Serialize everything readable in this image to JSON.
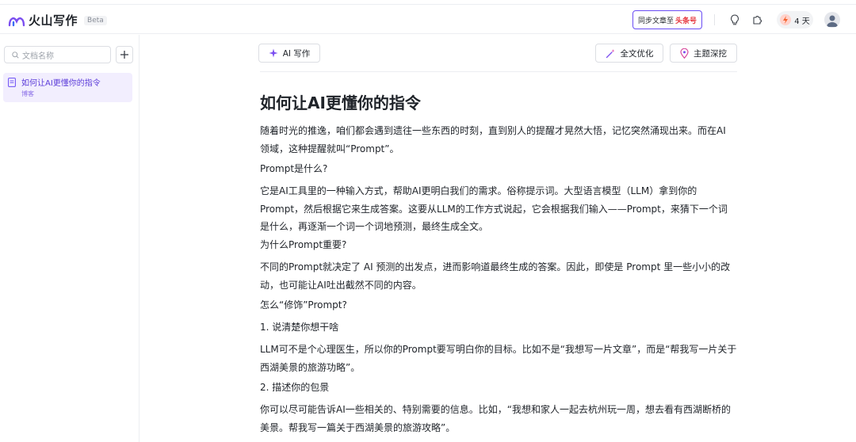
{
  "app": {
    "logo_text": "火山写作",
    "beta": "Beta"
  },
  "header": {
    "sync_prefix": "同步文章至",
    "sync_target": "头条号",
    "days": "4 天"
  },
  "sidebar": {
    "search_placeholder": "文档名称",
    "add_label": "+",
    "docs": [
      {
        "title": "如何让AI更懂你的指令",
        "subtitle": "博客"
      }
    ]
  },
  "toolbar": {
    "ai_write": "AI 写作",
    "optimize": "全文优化",
    "deep_dive": "主题深挖"
  },
  "document": {
    "title": "如何让AI更懂你的指令",
    "paragraphs": [
      [
        "随着时光的推逸，咱们都会遇到遗往一些东西的时刻，直到别人的提醒才晃然大悟，记忆突然涌现出来。而在AI",
        "领域，这种提醒就叫“Prompt”。"
      ],
      [
        "Prompt是什么?"
      ],
      [
        "它是AI工具里的一种输入方式，帮助AI更明白我们的需求。俗称提示词。大型语言模型（LLM）拿到你的",
        "Prompt，然后根据它来生成答案。这要从LLM的工作方式说起，它会根据我们输入——Prompt，来猜下一个词",
        "是什么，再逐渐一个词一个词地预测，最终生成全文。"
      ],
      [
        "为什么Prompt重要?"
      ],
      [
        "不同的Prompt就决定了 AI 预测的出发点，进而影响道最终生成的答案。因此，即使是 Prompt 里一些小小的改",
        "动，也可能让AI吐出截然不同的内容。"
      ],
      [
        "怎么“修饰”Prompt?"
      ],
      [
        "1. 说清楚你想干啥"
      ],
      [
        "LLM可不是个心理医生，所以你的Prompt要写明白你的目标。比如不是“我想写一片文章”，而是“帮我写一片关于",
        "西湖美景的旅游功略”。"
      ],
      [
        "2. 描述你的包景"
      ],
      [
        "你可以尽可能告诉AI一些相关的、特别需要的信息。比如，“我想和家人一起去杭州玩一周，想去看有西湖断桥的",
        "美景。帮我写一篇关于西湖美景的旅游攻略”。"
      ]
    ]
  },
  "colors": {
    "accent": "#6a4df4",
    "sync_highlight": "#e5333b",
    "selected_bg": "#f2eefe"
  },
  "icons": [
    "logo-icon",
    "bulb-icon",
    "plugin-icon",
    "bolt-icon",
    "avatar-icon",
    "search-icon",
    "plus-icon",
    "doc-icon",
    "sparkle-icon",
    "magic-wand-icon",
    "location-pin-icon"
  ]
}
